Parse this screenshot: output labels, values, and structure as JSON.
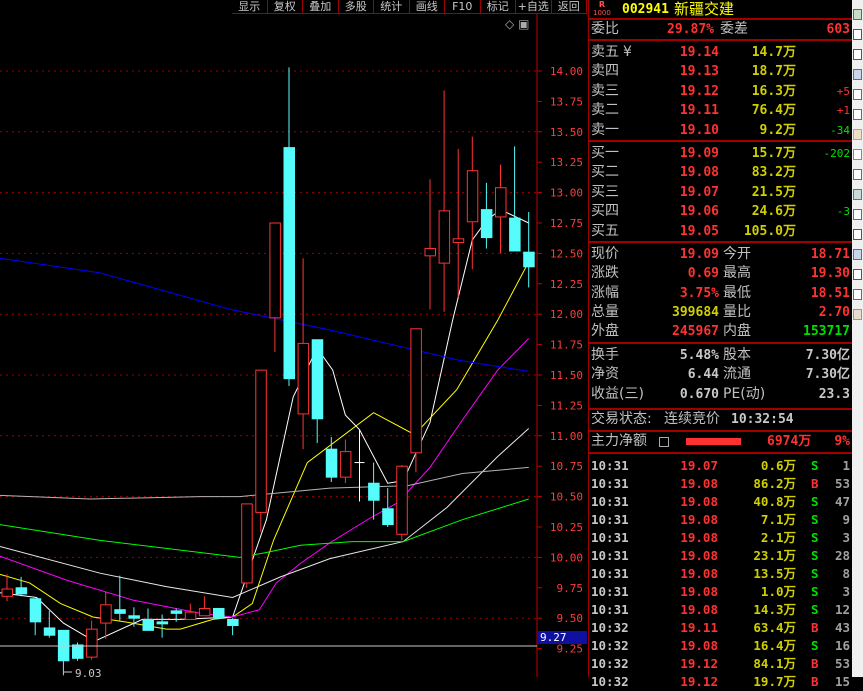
{
  "toolbar": [
    "显示",
    "复权",
    "叠加",
    "多股",
    "统计",
    "画线",
    "F10",
    "标记",
    "+自选",
    "返回"
  ],
  "chart_icons": {
    "diamond": "◇",
    "panel": "▣"
  },
  "stock": {
    "badge_top": "R",
    "badge_bottom": "1000",
    "code": "002941",
    "name": "新疆交建"
  },
  "weibi": {
    "label": "委比",
    "value": "29.87%",
    "diff_label": "委差",
    "diff": "603"
  },
  "sells": [
    {
      "label": "卖五",
      "mark": "¥",
      "price": "19.14",
      "vol": "14.7万",
      "chg": ""
    },
    {
      "label": "卖四",
      "mark": "",
      "price": "19.13",
      "vol": "18.7万",
      "chg": ""
    },
    {
      "label": "卖三",
      "mark": "",
      "price": "19.12",
      "vol": "16.3万",
      "chg": "+5"
    },
    {
      "label": "卖二",
      "mark": "",
      "price": "19.11",
      "vol": "76.4万",
      "chg": "+1"
    },
    {
      "label": "卖一",
      "mark": "",
      "price": "19.10",
      "vol": "9.2万",
      "chg": "-34"
    }
  ],
  "buys": [
    {
      "label": "买一",
      "price": "19.09",
      "vol": "15.7万",
      "chg": "-202"
    },
    {
      "label": "买二",
      "price": "19.08",
      "vol": "83.2万",
      "chg": ""
    },
    {
      "label": "买三",
      "price": "19.07",
      "vol": "21.5万",
      "chg": ""
    },
    {
      "label": "买四",
      "price": "19.06",
      "vol": "24.6万",
      "chg": "-3"
    },
    {
      "label": "买五",
      "price": "19.05",
      "vol": "105.0万",
      "chg": ""
    }
  ],
  "stats": [
    {
      "l1": "现价",
      "v1": "19.09",
      "c1": "red",
      "l2": "今开",
      "v2": "18.71",
      "c2": "red"
    },
    {
      "l1": "涨跌",
      "v1": "0.69",
      "c1": "red",
      "l2": "最高",
      "v2": "19.30",
      "c2": "red"
    },
    {
      "l1": "涨幅",
      "v1": "3.75%",
      "c1": "red",
      "l2": "最低",
      "v2": "18.51",
      "c2": "red"
    },
    {
      "l1": "总量",
      "v1": "399684",
      "c1": "yel",
      "l2": "量比",
      "v2": "2.70",
      "c2": "red"
    },
    {
      "l1": "外盘",
      "v1": "245967",
      "c1": "red",
      "l2": "内盘",
      "v2": "153717",
      "c2": "grn"
    }
  ],
  "fin": [
    {
      "l1": "换手",
      "v1": "5.48%",
      "l2": "股本",
      "v2": "7.30亿"
    },
    {
      "l1": "净资",
      "v1": "6.44",
      "l2": "流通",
      "v2": "7.30亿"
    },
    {
      "l1": "收益(三)",
      "v1": "0.670",
      "l2": "PE(动)",
      "v2": "23.3"
    }
  ],
  "status": {
    "label": "交易状态:",
    "value": "连续竞价",
    "time": "10:32:54"
  },
  "mainflow": {
    "label": "主力净额",
    "amount": "6974万",
    "pct": "9%"
  },
  "trades": [
    [
      "10:31",
      "19.07",
      "0.6万",
      "S",
      "1"
    ],
    [
      "10:31",
      "19.08",
      "86.2万",
      "B",
      "53"
    ],
    [
      "10:31",
      "19.08",
      "40.8万",
      "S",
      "47"
    ],
    [
      "10:31",
      "19.08",
      "7.1万",
      "S",
      "9"
    ],
    [
      "10:31",
      "19.08",
      "2.1万",
      "S",
      "3"
    ],
    [
      "10:31",
      "19.08",
      "23.1万",
      "S",
      "28"
    ],
    [
      "10:31",
      "19.08",
      "13.5万",
      "S",
      "8"
    ],
    [
      "10:31",
      "19.08",
      "1.0万",
      "S",
      "3"
    ],
    [
      "10:31",
      "19.08",
      "14.3万",
      "S",
      "12"
    ],
    [
      "10:32",
      "19.11",
      "63.4万",
      "B",
      "43"
    ],
    [
      "10:32",
      "19.08",
      "16.4万",
      "S",
      "16"
    ],
    [
      "10:32",
      "19.12",
      "84.1万",
      "B",
      "53"
    ],
    [
      "10:32",
      "19.12",
      "19.7万",
      "B",
      "15"
    ]
  ],
  "colors": {
    "up": "#ff3232",
    "down": "#54fcfc",
    "grid": "#a00000",
    "bg": "#000000"
  },
  "chart_data": {
    "type": "candlestick",
    "ylim": [
      9.0,
      14.25
    ],
    "yticks": [
      "14.00",
      "13.75",
      "13.50",
      "13.25",
      "13.00",
      "12.75",
      "12.50",
      "12.25",
      "12.00",
      "11.75",
      "11.50",
      "11.25",
      "11.00",
      "10.75",
      "10.50",
      "10.25",
      "10.00",
      "9.75",
      "9.50",
      "9.25"
    ],
    "marker_price": "9.27",
    "low_label": "9.03",
    "candles": [
      [
        9.68,
        9.86,
        9.64,
        9.74
      ],
      [
        9.75,
        9.84,
        9.68,
        9.7
      ],
      [
        9.66,
        9.66,
        9.36,
        9.47
      ],
      [
        9.42,
        9.56,
        9.34,
        9.36
      ],
      [
        9.4,
        9.4,
        9.03,
        9.15
      ],
      [
        9.28,
        9.3,
        9.15,
        9.17
      ],
      [
        9.18,
        9.48,
        9.16,
        9.41
      ],
      [
        9.46,
        9.72,
        9.33,
        9.61
      ],
      [
        9.57,
        9.85,
        9.48,
        9.54
      ],
      [
        9.52,
        9.59,
        9.43,
        9.5
      ],
      [
        9.49,
        9.58,
        9.4,
        9.4
      ],
      [
        9.47,
        9.53,
        9.34,
        9.46
      ],
      [
        9.56,
        9.58,
        9.47,
        9.54
      ],
      [
        9.49,
        9.62,
        9.49,
        9.55
      ],
      [
        9.52,
        9.68,
        9.52,
        9.58
      ],
      [
        9.58,
        9.58,
        9.49,
        9.5
      ],
      [
        9.49,
        9.5,
        9.36,
        9.44
      ],
      [
        9.79,
        10.44,
        9.75,
        10.44
      ],
      [
        10.37,
        11.54,
        10.21,
        11.54
      ],
      [
        11.97,
        12.75,
        11.69,
        12.75
      ],
      [
        13.37,
        14.03,
        11.41,
        11.47
      ],
      [
        11.18,
        12.46,
        10.89,
        11.76
      ],
      [
        11.79,
        11.79,
        10.94,
        11.14
      ],
      [
        10.89,
        10.99,
        10.62,
        10.66
      ],
      [
        10.66,
        10.97,
        10.61,
        10.87
      ],
      [
        10.78,
        11.05,
        10.46,
        10.78
      ],
      [
        10.61,
        10.78,
        10.31,
        10.47
      ],
      [
        10.4,
        10.57,
        10.25,
        10.27
      ],
      [
        10.19,
        10.76,
        10.14,
        10.75
      ],
      [
        10.86,
        11.88,
        10.7,
        11.88
      ],
      [
        12.48,
        13.11,
        12.04,
        12.54
      ],
      [
        12.42,
        13.84,
        12.02,
        12.85
      ],
      [
        12.59,
        13.36,
        12.14,
        12.62
      ],
      [
        12.76,
        13.46,
        12.37,
        13.18
      ],
      [
        12.86,
        13.08,
        12.54,
        12.63
      ],
      [
        12.8,
        13.23,
        12.5,
        13.04
      ],
      [
        12.79,
        13.38,
        12.52,
        12.52
      ],
      [
        12.51,
        12.84,
        12.22,
        12.39
      ]
    ],
    "lines": [
      {
        "name": "ma-white-short",
        "color": "#ffffff",
        "points": [
          [
            -0.5,
            9.71
          ],
          [
            2.1,
            9.67
          ],
          [
            4.0,
            9.46
          ],
          [
            6.2,
            9.31
          ],
          [
            9.6,
            9.49
          ],
          [
            12.3,
            9.49
          ],
          [
            16.0,
            9.51
          ],
          [
            18.4,
            10.31
          ],
          [
            20.3,
            11.32
          ],
          [
            22.0,
            11.72
          ],
          [
            23.1,
            11.54
          ],
          [
            24.0,
            11.17
          ],
          [
            25.0,
            11.05
          ],
          [
            27.0,
            10.61
          ],
          [
            28.1,
            10.63
          ],
          [
            30.0,
            11.11
          ],
          [
            31.6,
            11.95
          ],
          [
            33.0,
            12.61
          ],
          [
            34.0,
            12.77
          ],
          [
            35.0,
            12.86
          ],
          [
            37.0,
            12.75
          ]
        ]
      },
      {
        "name": "ma-yellow",
        "color": "#ffff00",
        "points": [
          [
            -0.5,
            9.86
          ],
          [
            1.6,
            9.79
          ],
          [
            3.8,
            9.62
          ],
          [
            6.1,
            9.51
          ],
          [
            8.9,
            9.46
          ],
          [
            11.3,
            9.41
          ],
          [
            12.3,
            9.41
          ],
          [
            14.6,
            9.49
          ],
          [
            16.0,
            9.51
          ],
          [
            17.4,
            9.62
          ],
          [
            18.9,
            10.14
          ],
          [
            21.3,
            10.78
          ],
          [
            26.0,
            11.19
          ],
          [
            28.9,
            11.01
          ],
          [
            31.9,
            11.38
          ],
          [
            34.8,
            11.95
          ],
          [
            37.0,
            12.43
          ]
        ]
      },
      {
        "name": "ma-magenta",
        "color": "#ff00ff",
        "points": [
          [
            -0.5,
            10.01
          ],
          [
            4.3,
            9.81
          ],
          [
            8.9,
            9.65
          ],
          [
            13.7,
            9.54
          ],
          [
            16.0,
            9.51
          ],
          [
            17.9,
            9.57
          ],
          [
            19.1,
            9.79
          ],
          [
            20.8,
            9.95
          ],
          [
            22.9,
            10.12
          ],
          [
            25.7,
            10.32
          ],
          [
            27.7,
            10.45
          ],
          [
            30.0,
            10.74
          ],
          [
            32.3,
            11.13
          ],
          [
            34.8,
            11.54
          ],
          [
            37.0,
            11.8
          ]
        ]
      },
      {
        "name": "ma-white-long",
        "color": "#e8e8e8",
        "points": [
          [
            -0.5,
            10.09
          ],
          [
            6.6,
            9.87
          ],
          [
            11.3,
            9.76
          ],
          [
            16.0,
            9.67
          ],
          [
            19.4,
            9.84
          ],
          [
            22.9,
            9.99
          ],
          [
            28.1,
            10.13
          ],
          [
            31.2,
            10.41
          ],
          [
            34.8,
            10.83
          ],
          [
            37.0,
            11.06
          ]
        ]
      },
      {
        "name": "ma-grey",
        "color": "#b4b4b4",
        "points": [
          [
            -0.5,
            10.51
          ],
          [
            5.9,
            10.48
          ],
          [
            13.7,
            10.5
          ],
          [
            16.5,
            10.5
          ],
          [
            22.9,
            10.57
          ],
          [
            28.4,
            10.59
          ],
          [
            32.3,
            10.69
          ],
          [
            37.0,
            10.74
          ]
        ]
      },
      {
        "name": "ma-green",
        "color": "#00ff00",
        "points": [
          [
            -0.5,
            10.27
          ],
          [
            6.6,
            10.14
          ],
          [
            13.7,
            10.04
          ],
          [
            16.5,
            10.0
          ],
          [
            18.4,
            10.04
          ],
          [
            20.8,
            10.1
          ],
          [
            24.5,
            10.13
          ],
          [
            28.1,
            10.13
          ],
          [
            32.3,
            10.31
          ],
          [
            37.0,
            10.48
          ]
        ]
      },
      {
        "name": "ma-blue",
        "color": "#0000ff",
        "points": [
          [
            -0.5,
            12.46
          ],
          [
            6.6,
            12.34
          ],
          [
            15.8,
            12.04
          ],
          [
            22.9,
            11.87
          ],
          [
            32.1,
            11.62
          ],
          [
            37.0,
            11.53
          ]
        ]
      }
    ]
  }
}
